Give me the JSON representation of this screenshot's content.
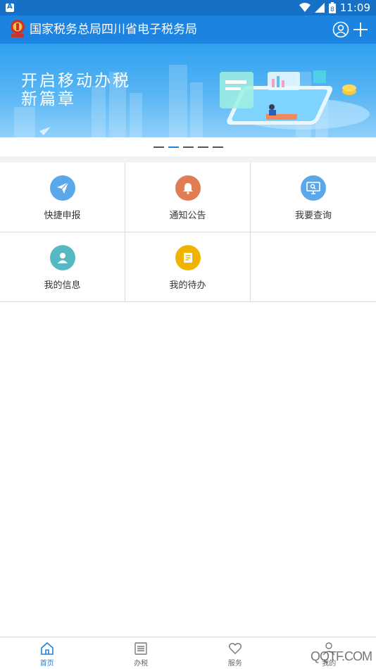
{
  "status_bar": {
    "time": "11:09",
    "battery": "8"
  },
  "header": {
    "title": "国家税务总局四川省电子税务局"
  },
  "banner": {
    "line1": "开启移动办税",
    "line2": "新篇章"
  },
  "carousel": {
    "count": 5,
    "active_index": 1
  },
  "menu": [
    {
      "label": "快捷申报",
      "icon": "paper-plane-icon",
      "color": "#5aa7ea"
    },
    {
      "label": "通知公告",
      "icon": "bell-icon",
      "color": "#e07d52"
    },
    {
      "label": "我要查询",
      "icon": "monitor-search-icon",
      "color": "#5aa7ea"
    },
    {
      "label": "我的信息",
      "icon": "person-icon",
      "color": "#56b8c3"
    },
    {
      "label": "我的待办",
      "icon": "checklist-icon",
      "color": "#f0b400"
    }
  ],
  "tabs": [
    {
      "label": "首页",
      "icon": "home-icon",
      "active": true
    },
    {
      "label": "办税",
      "icon": "list-icon",
      "active": false
    },
    {
      "label": "服务",
      "icon": "heart-icon",
      "active": false
    },
    {
      "label": "我的",
      "icon": "person-outline-icon",
      "active": false
    }
  ],
  "watermark": "QQTF.COM",
  "colors": {
    "primary": "#1c83e0",
    "status_bar": "#1671c6"
  }
}
